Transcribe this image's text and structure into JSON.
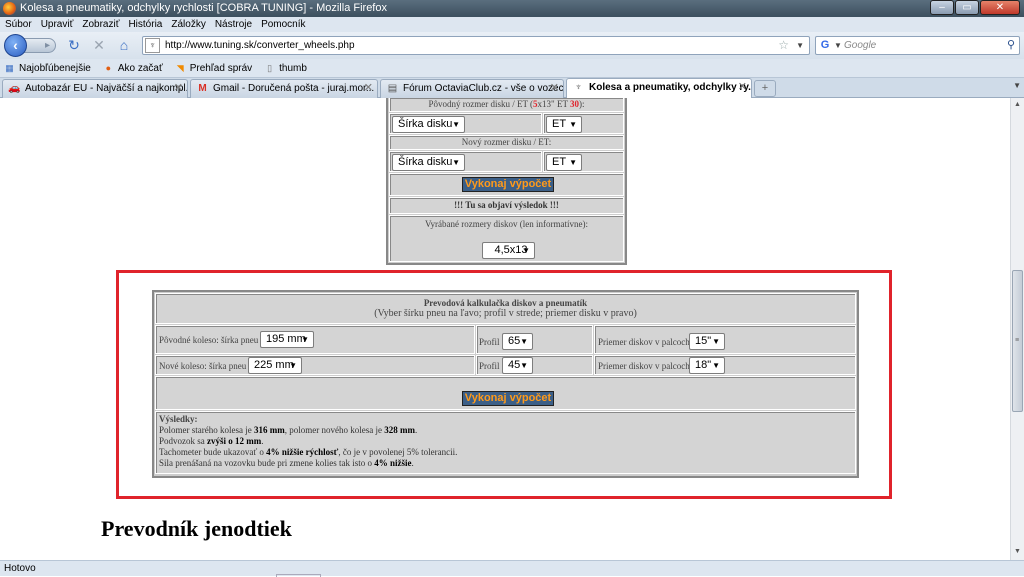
{
  "window": {
    "title": "Kolesa a pneumatiky, odchylky rychlosti [COBRA TUNING] - Mozilla Firefox"
  },
  "menu": [
    "Súbor",
    "Upraviť",
    "Zobraziť",
    "História",
    "Záložky",
    "Nástroje",
    "Pomocník"
  ],
  "nav": {
    "url": "http://www.tuning.sk/converter_wheels.php",
    "search_placeholder": "Google"
  },
  "bookmarks": [
    "Najobľúbenejšie",
    "Ako začať",
    "Prehľad správ",
    "thumb"
  ],
  "tabs": [
    {
      "label": "Autobazár EU - Najväčší a najkompl..."
    },
    {
      "label": "Gmail - Doručená pošta - juraj.mor..."
    },
    {
      "label": "Fórum OctaviaClub.cz - vše o vozec..."
    },
    {
      "label": "Kolesa a pneumatiky, odchylky ry..."
    }
  ],
  "top_form": {
    "orig_label_prefix": "Pôvodný rozmer disku / ET (",
    "orig_width": "5",
    "orig_mid": "x13\" ET ",
    "orig_et": "30",
    "orig_label_suffix": "):",
    "select_width": "Šírka disku",
    "select_et": "ET",
    "new_label": "Nový rozmer disku / ET:",
    "button": "Vykonaj výpočet",
    "result_placeholder": "!!! Tu sa objaví výsledok !!!",
    "produced_label": "Vyrábané rozmery diskov (len informatívne):",
    "produced_value": "4,5x13"
  },
  "calc": {
    "title": "Prevodová kalkulačka diskov a pneumatík",
    "subtitle": "(Vyber šírku pneu na ľavo; profil v strede; priemer disku v pravo)",
    "rows": [
      {
        "label": "Pôvodné koleso: šírka pneu",
        "width": "195 mm",
        "profil_label": "Profil",
        "profil": "65",
        "diam_label": "Priemer diskov v palcoch",
        "diam": "15\""
      },
      {
        "label": "Nové koleso: šírka pneu",
        "width": "225 mm",
        "profil_label": "Profil",
        "profil": "45",
        "diam_label": "Priemer diskov v palcoch",
        "diam": "18\""
      }
    ],
    "button": "Vykonaj výpočet",
    "results": {
      "title": "Výsledky:",
      "l1_a": "Polomer starého kolesa je ",
      "l1_b": "316 mm",
      "l1_c": ", polomer nového kolesa je ",
      "l1_d": "328 mm",
      "l1_e": ".",
      "l2_a": "Podvozok sa ",
      "l2_b": "zvýši o 12 mm",
      "l2_c": ".",
      "l3_a": "Tachometer bude ukazovať o ",
      "l3_b": "4% nižšie rýchlosť",
      "l3_c": ", čo je v povolenej 5% tolerancii.",
      "l4_a": "Sila prenášaná na vozovku bude pri zmene kolies tak isto o ",
      "l4_b": "4% nižšie",
      "l4_c": "."
    }
  },
  "heading": "Prevodník jenodtiek",
  "status": "Hotovo",
  "colors": {
    "highlight": "#e0232b",
    "button_bg": "#3c5f87",
    "button_text": "#ff9a1a",
    "accent_red": "#e0232b"
  }
}
